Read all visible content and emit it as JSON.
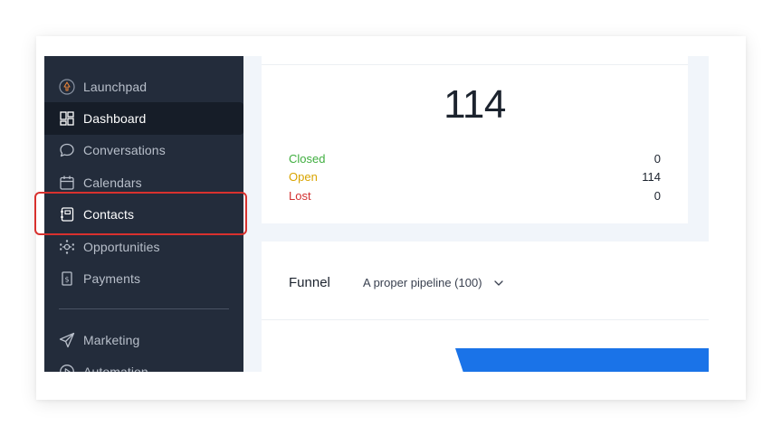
{
  "sidebar": {
    "items": [
      {
        "label": "Launchpad",
        "icon": "launchpad-icon"
      },
      {
        "label": "Dashboard",
        "icon": "dashboard-icon",
        "active": true
      },
      {
        "label": "Conversations",
        "icon": "chat-bubble-icon"
      },
      {
        "label": "Calendars",
        "icon": "calendar-icon"
      },
      {
        "label": "Contacts",
        "icon": "contacts-book-icon",
        "highlighted": true
      },
      {
        "label": "Opportunities",
        "icon": "opportunities-icon"
      },
      {
        "label": "Payments",
        "icon": "payments-icon"
      },
      {
        "label": "Marketing",
        "icon": "send-plane-icon"
      },
      {
        "label": "Automation",
        "icon": "automation-icon"
      }
    ]
  },
  "stats": {
    "total": "114",
    "rows": [
      {
        "label": "Closed",
        "value": "0",
        "color": "#3fae3f"
      },
      {
        "label": "Open",
        "value": "114",
        "color": "#d9a400"
      },
      {
        "label": "Lost",
        "value": "0",
        "color": "#d23030"
      }
    ]
  },
  "funnel": {
    "title": "Funnel",
    "pipeline_selected": "A proper pipeline (100)",
    "bar_color": "#1a73e8"
  },
  "colors": {
    "sidebar_bg": "#232c3b",
    "sidebar_active_bg": "#161d28",
    "highlight_border": "#d8312e",
    "main_bg": "#f1f5fa"
  }
}
